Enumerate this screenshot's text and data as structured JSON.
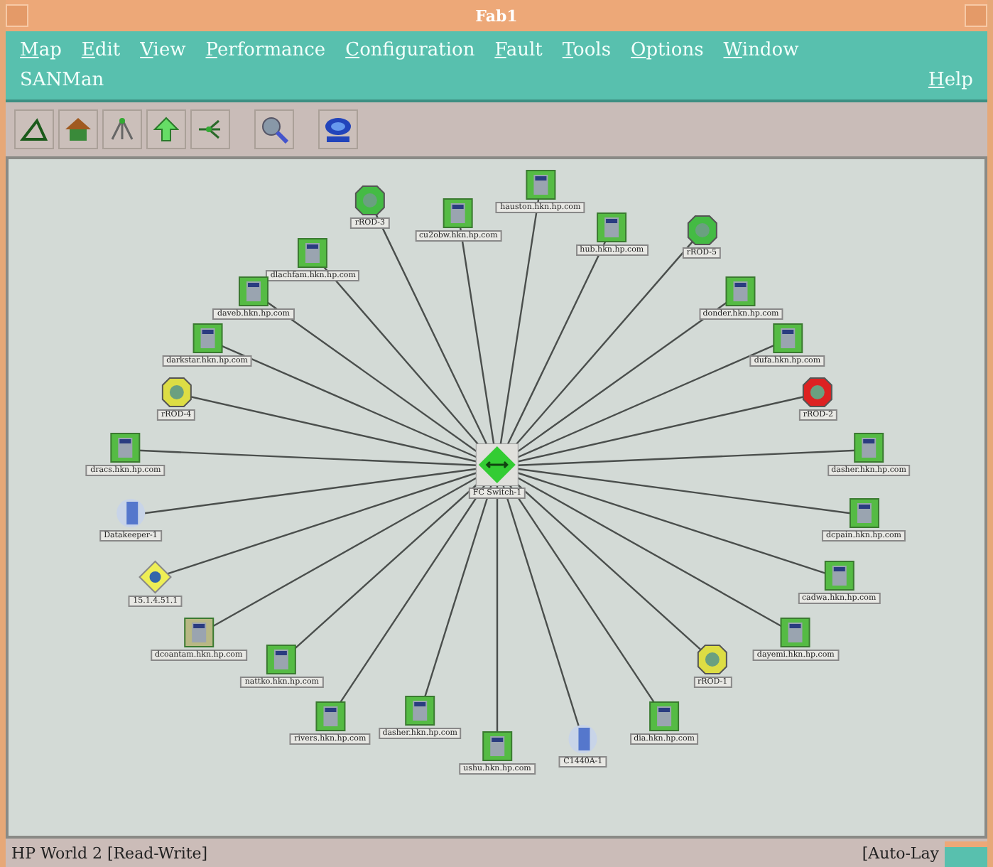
{
  "window": {
    "title": "Fab1"
  },
  "menu": {
    "items": [
      {
        "label": "Map",
        "underlined": true
      },
      {
        "label": "Edit",
        "underlined": true
      },
      {
        "label": "View",
        "underlined": true
      },
      {
        "label": "Performance",
        "underlined": true
      },
      {
        "label": "Configuration",
        "underlined": true
      },
      {
        "label": "Fault",
        "underlined": true
      },
      {
        "label": "Tools",
        "underlined": true
      },
      {
        "label": "Options",
        "underlined": true
      },
      {
        "label": "Window",
        "underlined": true
      }
    ],
    "second_row": [
      {
        "label": "SANMan",
        "underlined": false
      }
    ],
    "help": {
      "label": "Help",
      "underlined": true
    }
  },
  "toolbar": [
    {
      "kind": "triangle"
    },
    {
      "kind": "home"
    },
    {
      "kind": "tree"
    },
    {
      "kind": "up"
    },
    {
      "kind": "network"
    },
    {
      "kind": "search"
    },
    {
      "kind": "globe"
    }
  ],
  "map": {
    "center": {
      "kind": "switch",
      "label": "FC Switch-1",
      "color": "#33cc33"
    },
    "nodes": [
      {
        "kind": "server",
        "label": "hauston.hkn.hp.com",
        "color": "#55bb44"
      },
      {
        "kind": "server",
        "label": "hub.hkn.hp.com",
        "color": "#55bb44"
      },
      {
        "kind": "hub",
        "label": "rROD-5",
        "color": "#44bb44"
      },
      {
        "kind": "server",
        "label": "donder.hkn.hp.com",
        "color": "#55bb44"
      },
      {
        "kind": "server",
        "label": "dufa.hkn.hp.com",
        "color": "#55bb44"
      },
      {
        "kind": "hub",
        "label": "rROD-2",
        "color": "#dd2222"
      },
      {
        "kind": "server",
        "label": "dasher.hkn.hp.com",
        "color": "#55bb44"
      },
      {
        "kind": "server",
        "label": "dcpain.hkn.hp.com",
        "color": "#55bb44"
      },
      {
        "kind": "server",
        "label": "cadwa.hkn.hp.com",
        "color": "#55bb44"
      },
      {
        "kind": "server",
        "label": "dayemi.hkn.hp.com",
        "color": "#55bb44"
      },
      {
        "kind": "hub",
        "label": "rROD-1",
        "color": "#dddd44"
      },
      {
        "kind": "server",
        "label": "dia.hkn.hp.com",
        "color": "#55bb44"
      },
      {
        "kind": "disk",
        "label": "C1440A-1",
        "color": "#5577cc"
      },
      {
        "kind": "server",
        "label": "ushu.hkn.hp.com",
        "color": "#55bb44"
      },
      {
        "kind": "server",
        "label": "cu2obw.hkn.hp.com",
        "color": "#55bb44"
      },
      {
        "kind": "hub",
        "label": "rROD-3",
        "color": "#44bb44"
      },
      {
        "kind": "server",
        "label": "dlachfam.hkn.hp.com",
        "color": "#55bb44"
      },
      {
        "kind": "server",
        "label": "daveb.hkn.hp.com",
        "color": "#55bb44"
      },
      {
        "kind": "server",
        "label": "darkstar.hkn.hp.com",
        "color": "#55bb44"
      },
      {
        "kind": "hub",
        "label": "rROD-4",
        "color": "#dddd44"
      },
      {
        "kind": "server",
        "label": "dracs.hkn.hp.com",
        "color": "#55bb44"
      },
      {
        "kind": "disk",
        "label": "Datakeeper-1",
        "color": "#5577cc"
      },
      {
        "kind": "diamond",
        "label": "15.1.4.51.1",
        "color": "#eeee55"
      },
      {
        "kind": "server",
        "label": "dcoantam.hkn.hp.com",
        "color": "#b8b884"
      },
      {
        "kind": "server",
        "label": "nattko.hkn.hp.com",
        "color": "#55bb44"
      },
      {
        "kind": "server",
        "label": "rivers.hkn.hp.com",
        "color": "#55bb44"
      },
      {
        "kind": "server",
        "label": "dasher.hkn.hp.com",
        "color": "#55bb44"
      }
    ]
  },
  "status_bar": {
    "left": "HP World 2 [Read-Write]",
    "right": "[Auto-Lay"
  }
}
